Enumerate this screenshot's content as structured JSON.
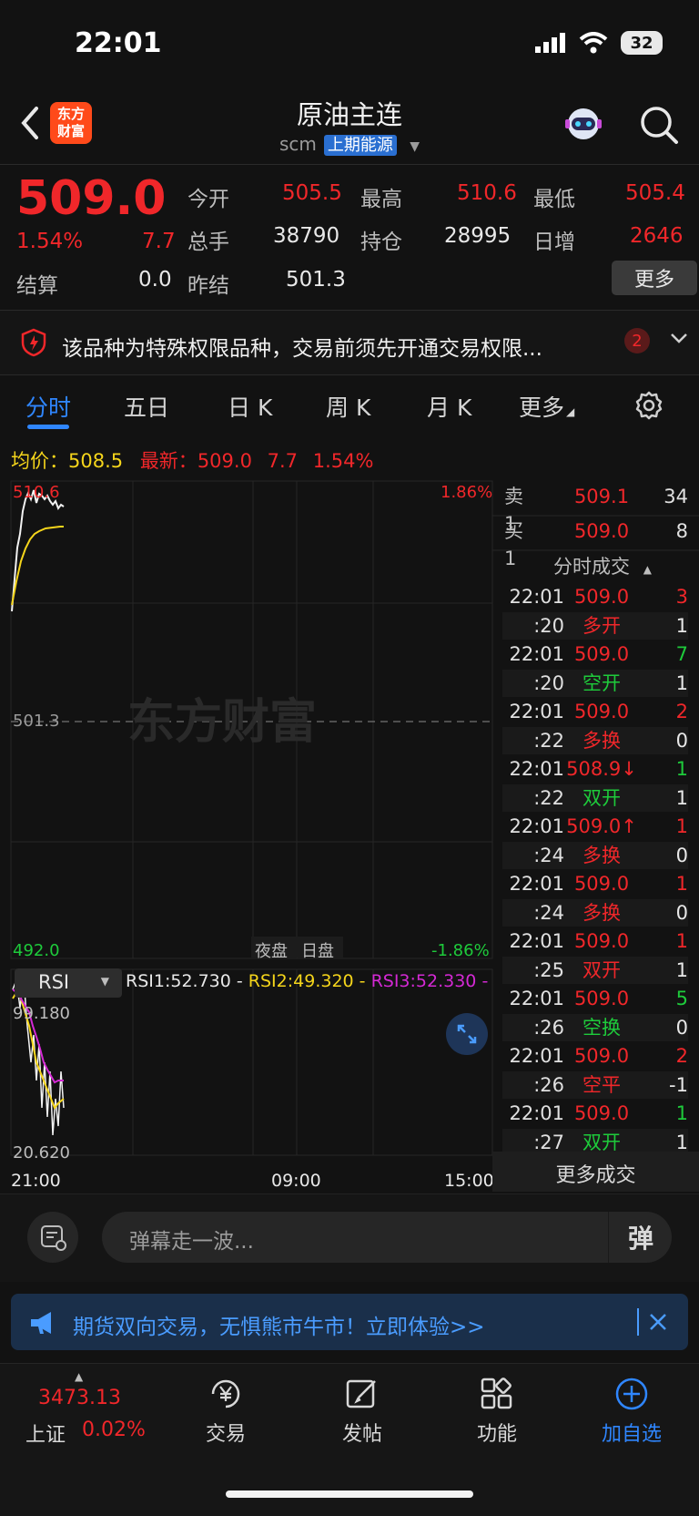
{
  "status_bar": {
    "time": "22:01",
    "battery": "32"
  },
  "header": {
    "title": "原油主连",
    "code": "scm",
    "exchange": "上期能源",
    "logo_line1": "东方",
    "logo_line2": "财富"
  },
  "quote": {
    "price": "509.0",
    "change_pct": "1.54%",
    "change": "7.7",
    "open_label": "今开",
    "open": "505.5",
    "high_label": "最高",
    "high": "510.6",
    "low_label": "最低",
    "low": "505.4",
    "volume_label": "总手",
    "volume": "38790",
    "oi_label": "持仓",
    "oi": "28995",
    "daily_inc_label": "日增",
    "daily_inc": "2646",
    "settle_label": "结算",
    "settle": "0.0",
    "prev_settle_label": "昨结",
    "prev_settle": "501.3",
    "more_label": "更多"
  },
  "notice": {
    "text": "该品种为特殊权限品种，交易前须先开通交易权限...",
    "count": "2"
  },
  "tabs": [
    "分时",
    "五日",
    "日 K",
    "周 K",
    "月 K",
    "更多"
  ],
  "info_line": {
    "avg_label": "均价：",
    "avg": "508.5",
    "last_label": "最新：",
    "last": "509.0",
    "chg": "7.7",
    "pct": "1.54%"
  },
  "chart": {
    "y_top": "510.6",
    "y_mid": "501.3",
    "y_bottom": "492.0",
    "pct_top": "1.86%",
    "pct_bottom": "-1.86%",
    "session_night": "夜盘",
    "session_day": "日盘",
    "watermark": "东方财富",
    "x_labels": [
      "21:00",
      "09:00",
      "15:00"
    ],
    "rsi_top": "99.180",
    "rsi_bottom": "20.620"
  },
  "indicator": {
    "name": "RSI",
    "rsi1": "RSI1:52.730 -",
    "rsi2": "RSI2:49.320 -",
    "rsi3": "RSI3:52.330 -"
  },
  "order_book": {
    "sell1_label": "卖 1",
    "sell1_price": "509.1",
    "sell1_vol": "34",
    "buy1_label": "买 1",
    "buy1_price": "509.0",
    "buy1_vol": "8"
  },
  "trades_title": "分时成交",
  "trades": [
    {
      "time": "22:01",
      "price": "509.0",
      "vol": "3",
      "pc": "red",
      "vc": "red"
    },
    {
      "time": ":20",
      "price": "多开",
      "vol": "1",
      "pc": "red",
      "vc": "white"
    },
    {
      "time": "22:01",
      "price": "509.0",
      "vol": "7",
      "pc": "red",
      "vc": "green"
    },
    {
      "time": ":20",
      "price": "空开",
      "vol": "1",
      "pc": "green",
      "vc": "white"
    },
    {
      "time": "22:01",
      "price": "509.0",
      "vol": "2",
      "pc": "red",
      "vc": "red"
    },
    {
      "time": ":22",
      "price": "多换",
      "vol": "0",
      "pc": "red",
      "vc": "white"
    },
    {
      "time": "22:01",
      "price": "508.9↓",
      "vol": "1",
      "pc": "red",
      "vc": "green"
    },
    {
      "time": ":22",
      "price": "双开",
      "vol": "1",
      "pc": "green",
      "vc": "white"
    },
    {
      "time": "22:01",
      "price": "509.0↑",
      "vol": "1",
      "pc": "red",
      "vc": "red"
    },
    {
      "time": ":24",
      "price": "多换",
      "vol": "0",
      "pc": "red",
      "vc": "white"
    },
    {
      "time": "22:01",
      "price": "509.0",
      "vol": "1",
      "pc": "red",
      "vc": "red"
    },
    {
      "time": ":24",
      "price": "多换",
      "vol": "0",
      "pc": "red",
      "vc": "white"
    },
    {
      "time": "22:01",
      "price": "509.0",
      "vol": "1",
      "pc": "red",
      "vc": "red"
    },
    {
      "time": ":25",
      "price": "双开",
      "vol": "1",
      "pc": "red",
      "vc": "white"
    },
    {
      "time": "22:01",
      "price": "509.0",
      "vol": "5",
      "pc": "red",
      "vc": "green"
    },
    {
      "time": ":26",
      "price": "空换",
      "vol": "0",
      "pc": "green",
      "vc": "white"
    },
    {
      "time": "22:01",
      "price": "509.0",
      "vol": "2",
      "pc": "red",
      "vc": "red"
    },
    {
      "time": ":26",
      "price": "空平",
      "vol": "-1",
      "pc": "red",
      "vc": "white"
    },
    {
      "time": "22:01",
      "price": "509.0",
      "vol": "1",
      "pc": "red",
      "vc": "green"
    },
    {
      "time": ":27",
      "price": "双开",
      "vol": "1",
      "pc": "green",
      "vc": "white"
    }
  ],
  "more_trades": "更多成交",
  "comment": {
    "placeholder": "弹幕走一波...",
    "danmu_label": "弹"
  },
  "banner": {
    "text": "期货双向交易，无惧熊市牛市！立即体验>>"
  },
  "bottom_nav": {
    "index_value": "3473.13",
    "index_name": "上证",
    "index_pct": "0.02%",
    "trade": "交易",
    "post": "发帖",
    "functions": "功能",
    "add_watch": "加自选"
  },
  "colors": {
    "up": "#f0272a",
    "down": "#1ecb3b",
    "accent": "#2f86ff",
    "avg_line": "#f5d51b"
  }
}
